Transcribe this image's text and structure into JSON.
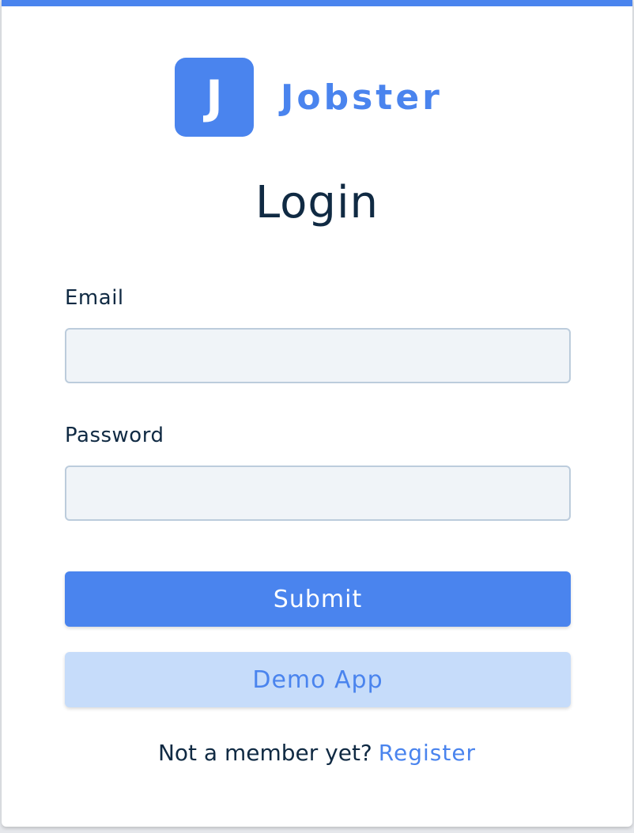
{
  "logo": {
    "mark": "J",
    "text": "Jobster"
  },
  "title": "Login",
  "form": {
    "email": {
      "label": "Email",
      "value": "",
      "placeholder": ""
    },
    "password": {
      "label": "Password",
      "value": "",
      "placeholder": ""
    }
  },
  "buttons": {
    "submit": "Submit",
    "demo": "Demo App"
  },
  "footer": {
    "prompt": "Not a member yet?",
    "link": "Register"
  },
  "colors": {
    "accent": "#4a84ee",
    "accent_light": "#c6dcfa",
    "text_dark": "#102a43",
    "input_bg": "#f0f4f8",
    "input_border": "#bcccdc"
  }
}
